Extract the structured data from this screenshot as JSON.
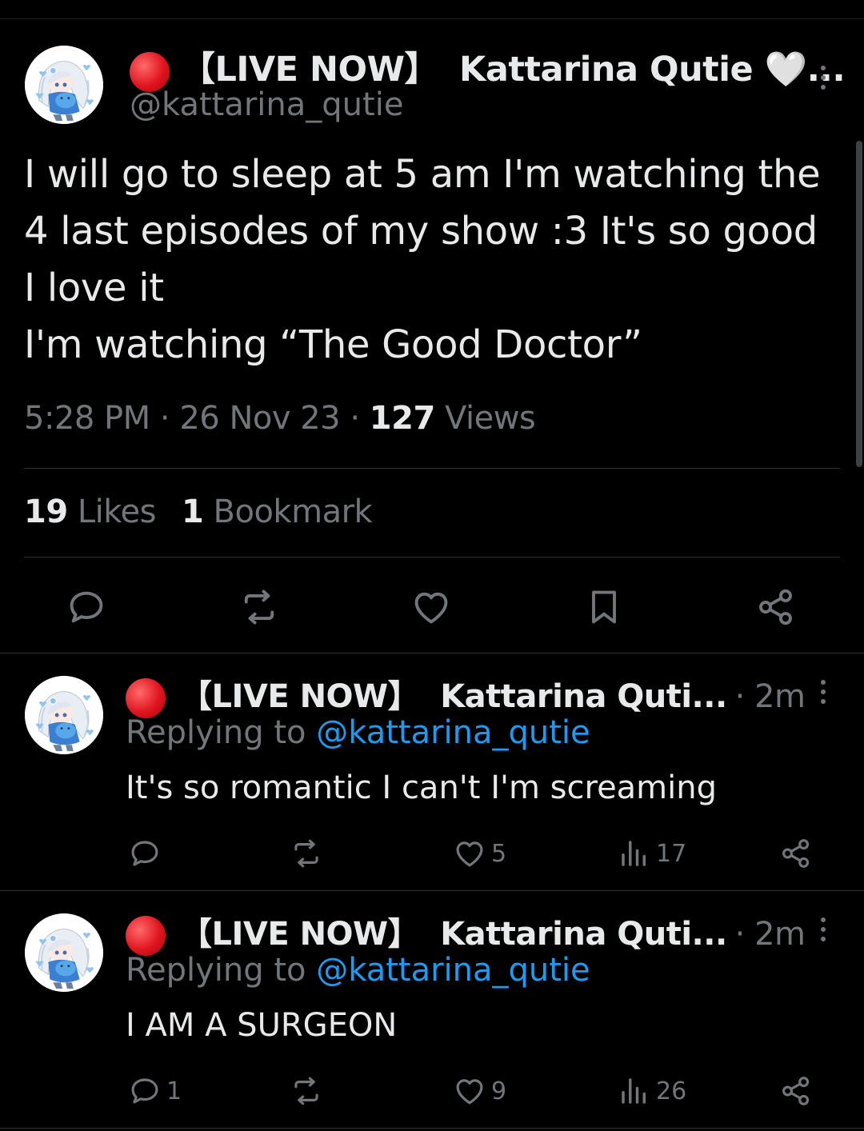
{
  "main_tweet": {
    "prefix": "【LIVE NOW】",
    "display_name": "Kattarina Qutie 🤍...",
    "handle": "@kattarina_qutie",
    "text_lines": [
      "I will go to sleep at 5 am I'm watching the 4 last episodes of my show :3 It's so good I love it",
      "I'm watching “The Good Doctor”"
    ],
    "time": "5:28 PM",
    "date": "26 Nov 23",
    "views_count": "127",
    "views_label": "Views",
    "likes_count": "19",
    "likes_label": "Likes",
    "bookmarks_count": "1",
    "bookmarks_label": "Bookmark",
    "actions": [
      "reply-icon",
      "retweet-icon",
      "like-icon",
      "bookmark-icon",
      "share-icon"
    ]
  },
  "replies": [
    {
      "prefix": "【LIVE NOW】",
      "display_name": "Kattarina Quti...",
      "time": "· 2m",
      "replying_label": "Replying to",
      "replying_handle": "@kattarina_qutie",
      "text": "It's so romantic I can't I'm screaming",
      "reply_count": "",
      "retweet_count": "",
      "like_count": "5",
      "view_count": "17"
    },
    {
      "prefix": "【LIVE NOW】",
      "display_name": "Kattarina Quti...",
      "time": "· 2m",
      "replying_label": "Replying to",
      "replying_handle": "@kattarina_qutie",
      "text": "I AM A SURGEON",
      "reply_count": "1",
      "retweet_count": "",
      "like_count": "9",
      "view_count": "26"
    }
  ],
  "colors": {
    "background": "#000000",
    "text": "#e7e9ea",
    "secondary": "#71767b",
    "link": "#1d9bf0",
    "divider": "#2f3336",
    "live_dot": "#e0141e"
  }
}
